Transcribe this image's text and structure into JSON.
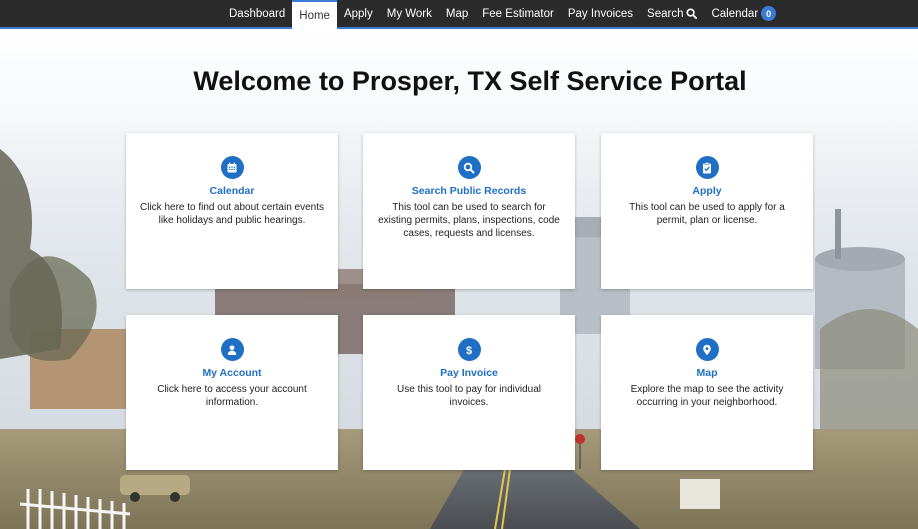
{
  "nav": {
    "items": [
      {
        "label": "Dashboard"
      },
      {
        "label": "Home",
        "active": true
      },
      {
        "label": "Apply"
      },
      {
        "label": "My Work"
      },
      {
        "label": "Map"
      },
      {
        "label": "Fee Estimator"
      },
      {
        "label": "Pay Invoices"
      },
      {
        "label": "Search",
        "icon": "search-icon"
      },
      {
        "label": "Calendar",
        "badge": "0"
      }
    ],
    "accent_color": "#3a7bd5",
    "background_color": "#2b2b2b"
  },
  "page": {
    "title": "Welcome to Prosper, TX Self Service Portal"
  },
  "tiles": [
    {
      "title": "Calendar",
      "icon": "calendar-icon",
      "description": "Click here to find out about certain events like holidays and public hearings."
    },
    {
      "title": "Search Public Records",
      "icon": "search-icon",
      "description": "This tool can be used to search for existing permits, plans, inspections, code cases, requests and licenses."
    },
    {
      "title": "Apply",
      "icon": "clipboard-check-icon",
      "description": "This tool can be used to apply for a permit, plan or license."
    },
    {
      "title": "My Account",
      "icon": "user-icon",
      "description": "Click here to access your account information."
    },
    {
      "title": "Pay Invoice",
      "icon": "dollar-icon",
      "description": "Use this tool to pay for individual invoices."
    },
    {
      "title": "Map",
      "icon": "map-marker-icon",
      "description": "Explore the map to see the activity occurring in your neighborhood."
    }
  ],
  "tile_accent_color": "#1f6fc5"
}
